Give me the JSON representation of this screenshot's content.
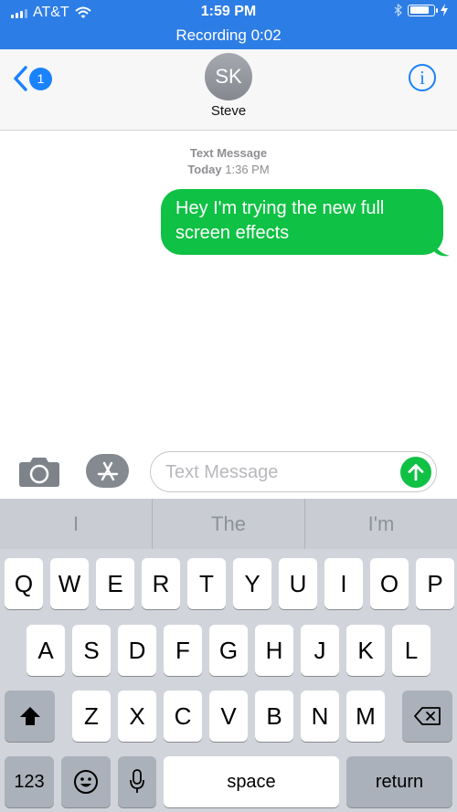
{
  "status_bar": {
    "carrier": "AT&T",
    "time": "1:59 PM",
    "recording_label": "Recording",
    "recording_time": "0:02",
    "battery_level": 0.85,
    "color": "#2d7de6"
  },
  "header": {
    "back_badge": "1",
    "avatar_initials": "SK",
    "contact_name": "Steve",
    "info_label": "i"
  },
  "conversation": {
    "service": "Text Message",
    "day": "Today",
    "time": "1:36 PM",
    "messages": [
      {
        "text": "Hey I'm trying the new full screen effects",
        "direction": "outgoing",
        "bubble_color": "#0fc144"
      }
    ]
  },
  "input_bar": {
    "placeholder": "Text Message",
    "value": ""
  },
  "keyboard": {
    "predictions": [
      "I",
      "The",
      "I'm"
    ],
    "row1": [
      "Q",
      "W",
      "E",
      "R",
      "T",
      "Y",
      "U",
      "I",
      "O",
      "P"
    ],
    "row2": [
      "A",
      "S",
      "D",
      "F",
      "G",
      "H",
      "J",
      "K",
      "L"
    ],
    "row3": [
      "Z",
      "X",
      "C",
      "V",
      "B",
      "N",
      "M"
    ],
    "numbers_label": "123",
    "space_label": "space",
    "return_label": "return",
    "icons": [
      "shift-icon",
      "backspace-icon",
      "emoji-icon",
      "microphone-icon"
    ]
  }
}
